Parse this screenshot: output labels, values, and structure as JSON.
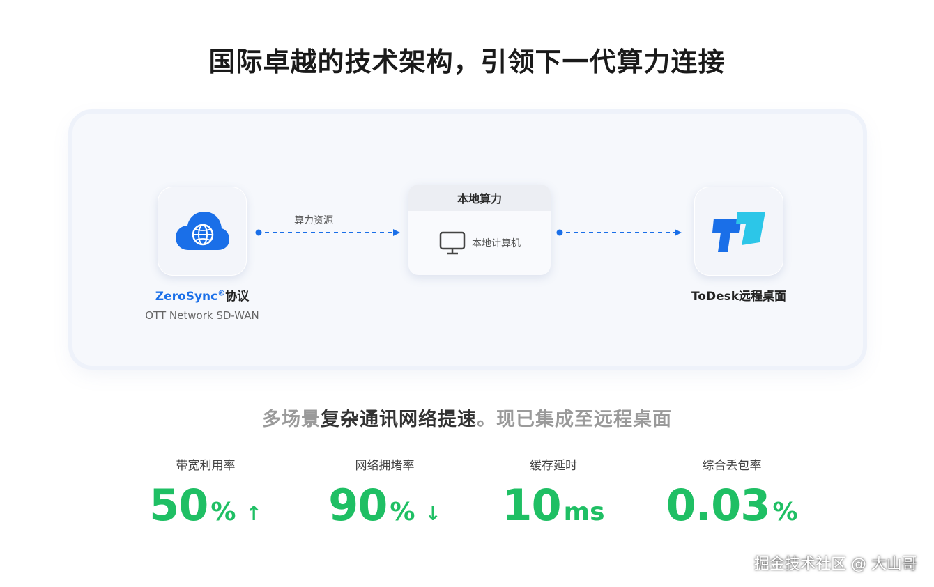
{
  "page": {
    "title": "国际卓越的技术架构，引领下一代算力连接"
  },
  "diagram": {
    "left_node": {
      "brand": "ZeroSync",
      "reg": "®",
      "suffix": "协议",
      "subtitle": "OTT Network SD-WAN",
      "icon": "cloud-network-icon"
    },
    "arrow_label": "算力资源",
    "center_node": {
      "header": "本地算力",
      "item": "本地计算机",
      "icon": "monitor-icon"
    },
    "right_node": {
      "caption": "ToDesk远程桌面",
      "icon": "todesk-logo-icon"
    }
  },
  "subtitle": {
    "part1": "多场景",
    "part2": "复杂通讯网络提速",
    "part3": "。现已集成至远程桌面"
  },
  "metrics": [
    {
      "label": "带宽利用率",
      "value": "50",
      "unit": "%",
      "trend": "↑"
    },
    {
      "label": "网络拥堵率",
      "value": "90",
      "unit": "%",
      "trend": "↓"
    },
    {
      "label": "缓存延时",
      "value": "10",
      "unit": "ms",
      "trend": ""
    },
    {
      "label": "综合丢包率",
      "value": "0.03",
      "unit": "%",
      "trend": ""
    }
  ],
  "colors": {
    "accent_blue": "#1a6fe8",
    "metric_green": "#1fbf64"
  },
  "watermark": "掘金技术社区 @ 大山哥"
}
